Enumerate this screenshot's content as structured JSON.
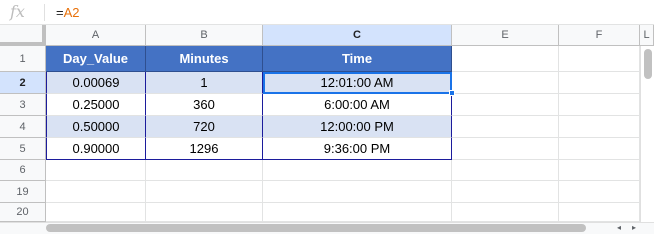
{
  "formula_bar": {
    "fx_label": "fx",
    "equals": "=",
    "ref": "A2"
  },
  "columns": [
    "A",
    "B",
    "C",
    "E",
    "F",
    "L"
  ],
  "rows": [
    "1",
    "2",
    "3",
    "4",
    "5",
    "6",
    "19",
    "20"
  ],
  "table": {
    "headers": [
      "Day_Value",
      "Minutes",
      "Time"
    ],
    "data": [
      [
        "0.00069",
        "1",
        "12:01:00 AM"
      ],
      [
        "0.25000",
        "360",
        "6:00:00 AM"
      ],
      [
        "0.50000",
        "720",
        "12:00:00 PM"
      ],
      [
        "0.90000",
        "1296",
        "9:36:00 PM"
      ]
    ]
  },
  "colors": {
    "header_fill": "#4472c4",
    "band_fill": "#d9e2f3",
    "selection": "#1a73e8",
    "formula_ref": "#e8710a"
  },
  "scroll": {
    "left_arrow": "◂",
    "right_arrow": "▸"
  }
}
